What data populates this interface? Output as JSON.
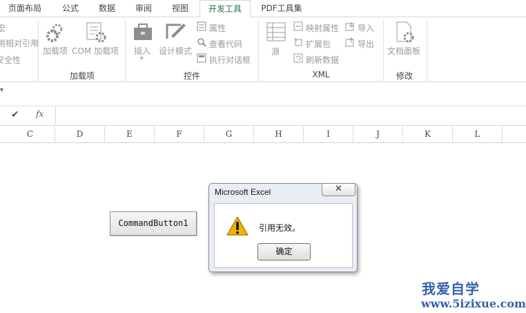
{
  "tabs": [
    "页面布局",
    "公式",
    "数据",
    "审阅",
    "视图",
    "开发工具",
    "PDF工具集"
  ],
  "active_tab": "开发工具",
  "ribbon": {
    "code_partial": [
      "宏",
      "用相对引用",
      "安全性"
    ],
    "addins": {
      "addin_label": "加载项",
      "com_label": "COM 加载项",
      "group_label": "加载项"
    },
    "controls": {
      "insert_label": "插入",
      "design_label": "设计模式",
      "properties_label": "属性",
      "viewcode_label": "查看代码",
      "rundialog_label": "执行对话框",
      "group_label": "控件"
    },
    "xml": {
      "source_label": "源",
      "mapprops_label": "映射属性",
      "expansion_label": "扩展包",
      "refresh_label": "刷新数据",
      "import_label": "导入",
      "export_label": "导出",
      "group_label": "XML"
    },
    "modify": {
      "docpanel_label": "文档面板",
      "group_label": "修改"
    }
  },
  "formula_bar": {
    "enter_icon": "✔",
    "fx_label": "fx",
    "value": ""
  },
  "columns": [
    "C",
    "D",
    "E",
    "F",
    "G",
    "H",
    "I",
    "J",
    "K",
    "L"
  ],
  "sheet": {
    "command_button_label": "CommandButton1"
  },
  "dialog": {
    "title": "Microsoft Excel",
    "close_glyph": "✕",
    "message": "引用无效。",
    "ok_label": "确定",
    "icon": "warning-icon"
  },
  "watermark": {
    "line1": "我爱自学",
    "line2": "www.5izixue.com"
  },
  "colors": {
    "accent": "#217346",
    "warning": "#f2b300",
    "watermark": "#3561a8"
  }
}
